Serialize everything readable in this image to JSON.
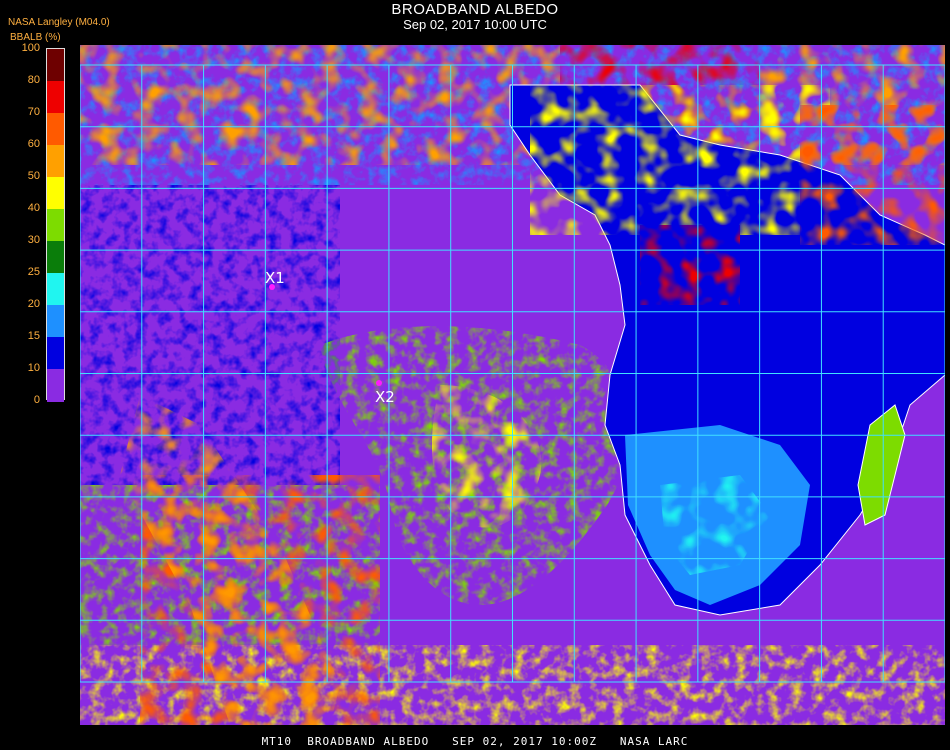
{
  "header": {
    "title": "BROADBAND ALBEDO",
    "subtitle": "Sep 02, 2017 10:00 UTC",
    "source": "NASA Langley (M04.0)",
    "units": "BBALB (%)"
  },
  "legend": {
    "ticks": [
      "100",
      "80",
      "70",
      "60",
      "50",
      "40",
      "30",
      "25",
      "20",
      "15",
      "10",
      "0"
    ],
    "bands": [
      {
        "from": 80,
        "to": 100,
        "color": "#6e0000"
      },
      {
        "from": 70,
        "to": 80,
        "color": "#ee0000"
      },
      {
        "from": 60,
        "to": 70,
        "color": "#ff5a00"
      },
      {
        "from": 50,
        "to": 60,
        "color": "#ffa000"
      },
      {
        "from": 40,
        "to": 50,
        "color": "#ffff00"
      },
      {
        "from": 30,
        "to": 40,
        "color": "#7ddc00"
      },
      {
        "from": 25,
        "to": 30,
        "color": "#0a7d0a"
      },
      {
        "from": 20,
        "to": 25,
        "color": "#20f5f0"
      },
      {
        "from": 15,
        "to": 20,
        "color": "#1e90ff"
      },
      {
        "from": 10,
        "to": 15,
        "color": "#0000e0"
      },
      {
        "from": 0,
        "to": 10,
        "color": "#8a2be2"
      }
    ]
  },
  "map": {
    "grid_color": "#40e0ff",
    "ocean_color": "#8a2be2",
    "markers": [
      {
        "label": "X1",
        "color": "#ff1aff"
      },
      {
        "label": "X2",
        "color": "#ff1aff"
      }
    ]
  },
  "footer": "MT10  BROADBAND ALBEDO   SEP 02, 2017 10:00Z   NASA LARC"
}
